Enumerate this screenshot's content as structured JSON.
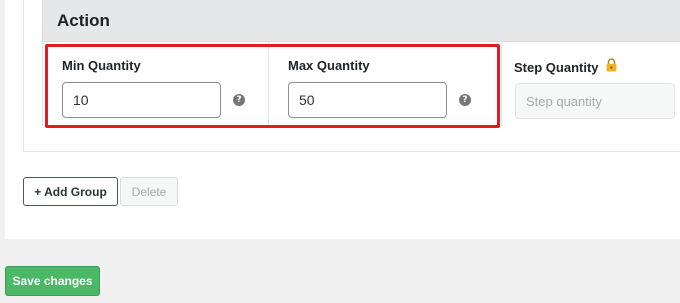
{
  "section": {
    "title": "Action"
  },
  "fields": {
    "min": {
      "label": "Min Quantity",
      "value": "10"
    },
    "max": {
      "label": "Max Quantity",
      "value": "50"
    },
    "step": {
      "label": "Step Quantity",
      "placeholder": "Step quantity"
    }
  },
  "help_icon_glyph": "?",
  "icons": {
    "help": "question-circle-icon",
    "lock": "lock-icon"
  },
  "buttons": {
    "add_group": "+ Add Group",
    "delete": "Delete",
    "save": "Save changes"
  },
  "colors": {
    "highlight": "#e31b23",
    "save_button": "#4ab866",
    "lock": "#f0b323"
  }
}
